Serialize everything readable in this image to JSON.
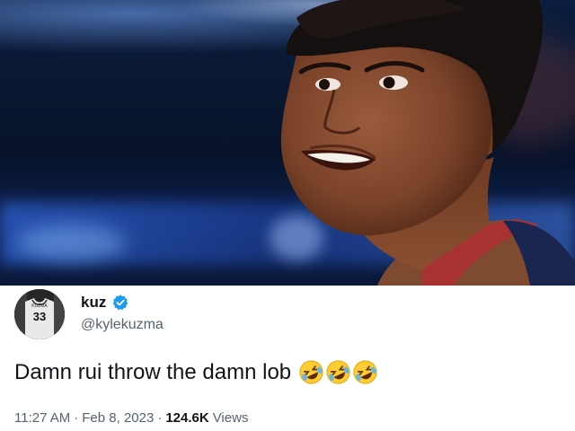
{
  "photo": {
    "icon": "player-photo"
  },
  "tweet": {
    "display_name": "kuz",
    "handle": "@kylekuzma",
    "verified": true,
    "avatar_jersey_number": "33",
    "text": "Damn rui throw the damn lob",
    "emoji": [
      "rolling-on-floor-laughing",
      "rolling-on-floor-laughing",
      "rolling-on-floor-laughing"
    ],
    "time": "11:27 AM",
    "separator": "·",
    "date": "Feb 8, 2023",
    "views_count": "124.6K",
    "views_label": "Views"
  },
  "colors": {
    "verified_blue": "#1d9bf0",
    "secondary_text": "#536471",
    "primary_text": "#0f1419"
  }
}
